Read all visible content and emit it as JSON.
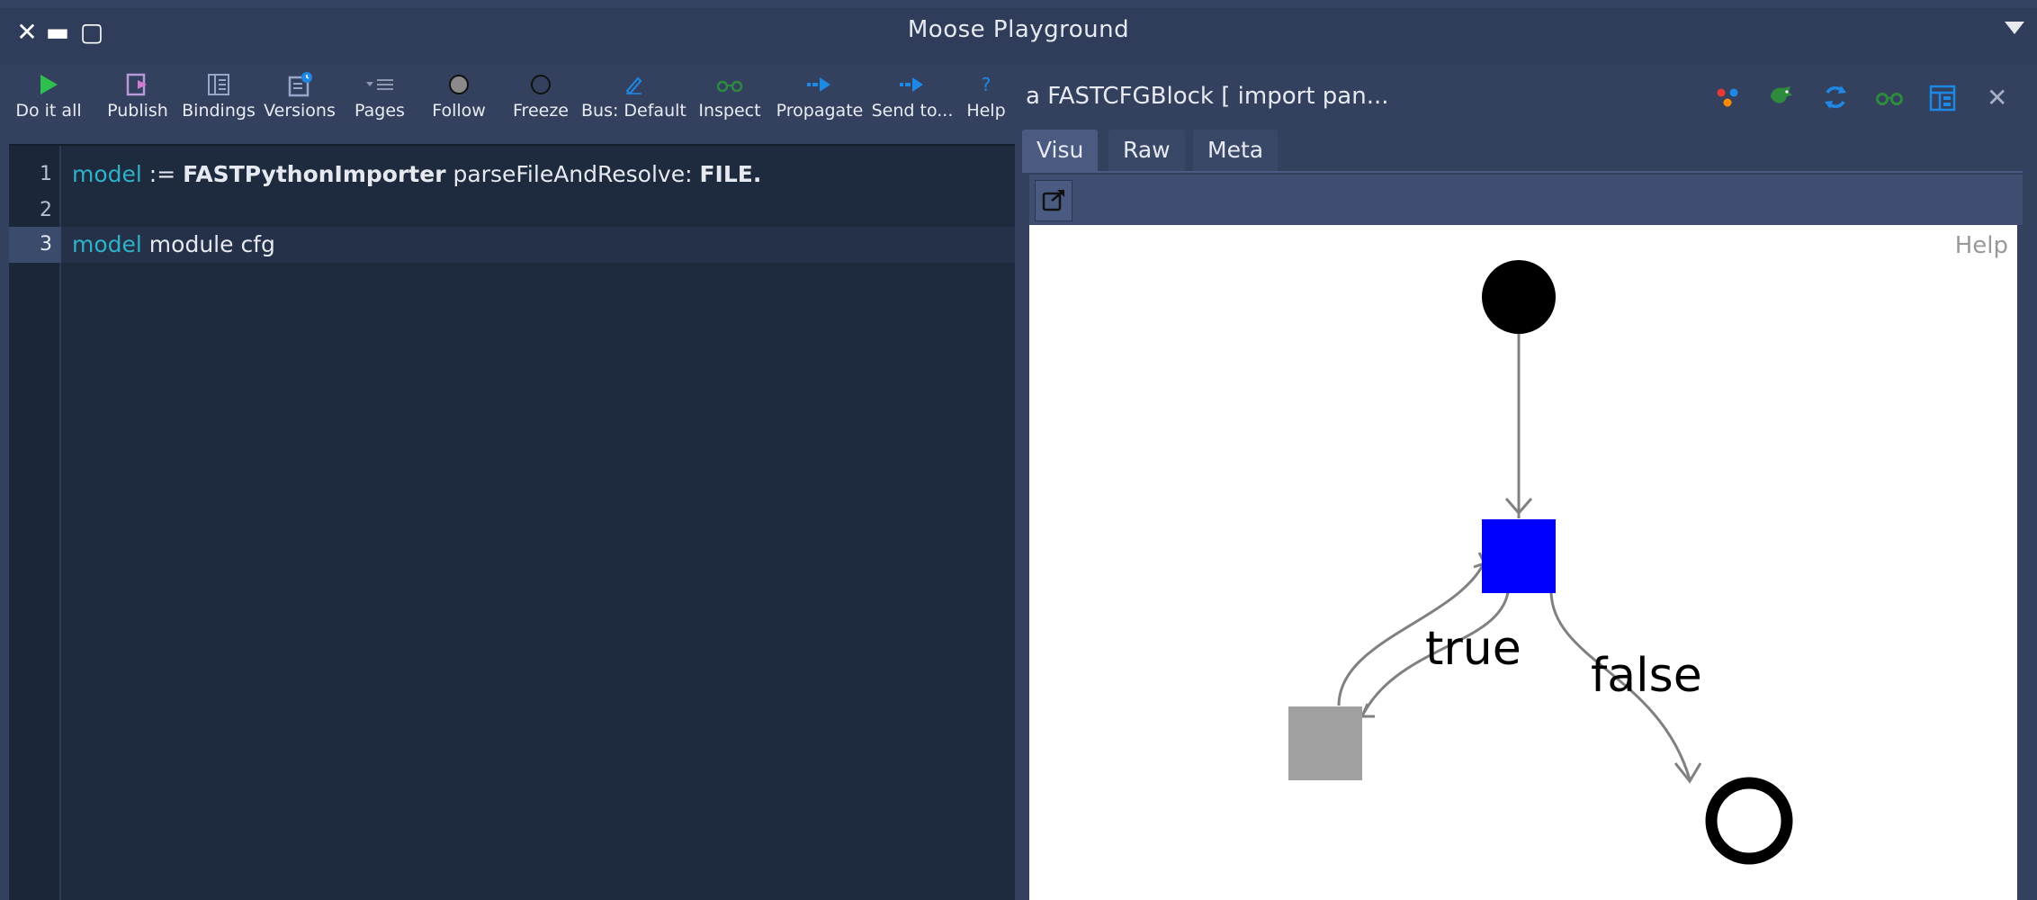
{
  "window": {
    "title": "Moose Playground",
    "close_glyph": "✕",
    "minimize_glyph": "▬",
    "maximize_glyph": "▢"
  },
  "toolbar": {
    "items": [
      {
        "label": "Do it all",
        "icon": "play-icon"
      },
      {
        "label": "Publish",
        "icon": "publish-icon"
      },
      {
        "label": "Bindings",
        "icon": "bindings-icon"
      },
      {
        "label": "Versions",
        "icon": "versions-icon"
      },
      {
        "label": "Pages",
        "icon": "pages-icon"
      },
      {
        "label": "Follow",
        "icon": "follow-icon"
      },
      {
        "label": "Freeze",
        "icon": "freeze-icon"
      },
      {
        "label": "Bus: Default",
        "icon": "bus-icon"
      },
      {
        "label": "Inspect",
        "icon": "inspect-icon"
      },
      {
        "label": "Propagate",
        "icon": "propagate-icon"
      },
      {
        "label": "Send to...",
        "icon": "send-icon"
      },
      {
        "label": "Help",
        "icon": "help-icon"
      }
    ]
  },
  "editor": {
    "line_numbers": [
      "1",
      "2",
      "3"
    ],
    "current_line": "3",
    "lines": [
      {
        "t1": "model",
        "t2": " := ",
        "t3": "FASTPythonImporter",
        "t4": " parseFileAndResolve: ",
        "t5": "FILE."
      },
      {},
      {
        "t1": "model",
        "t2": " module cfg"
      }
    ]
  },
  "inspector": {
    "title": "a FASTCFGBlock [ import pan...",
    "close_glyph": "✕",
    "tabs": [
      "Visu",
      "Raw",
      "Meta"
    ],
    "active_tab": "Visu",
    "help_label": "Help",
    "actions": [
      "mondrian-icon",
      "moose-icon",
      "refresh-icon",
      "inspect-icon",
      "browse-icon"
    ]
  },
  "graph": {
    "edge_labels": {
      "true": "true",
      "false": "false"
    },
    "colors": {
      "start_node": "#000000",
      "current_block": "#0000ff",
      "true_block": "#a0a0a0",
      "end_node": "#000000",
      "edge": "#808080"
    }
  },
  "colors": {
    "background": "#33415f",
    "editor_bg": "#1e2a3d",
    "keyword": "#2fb2c8",
    "accent_blue": "#1e88e5"
  }
}
